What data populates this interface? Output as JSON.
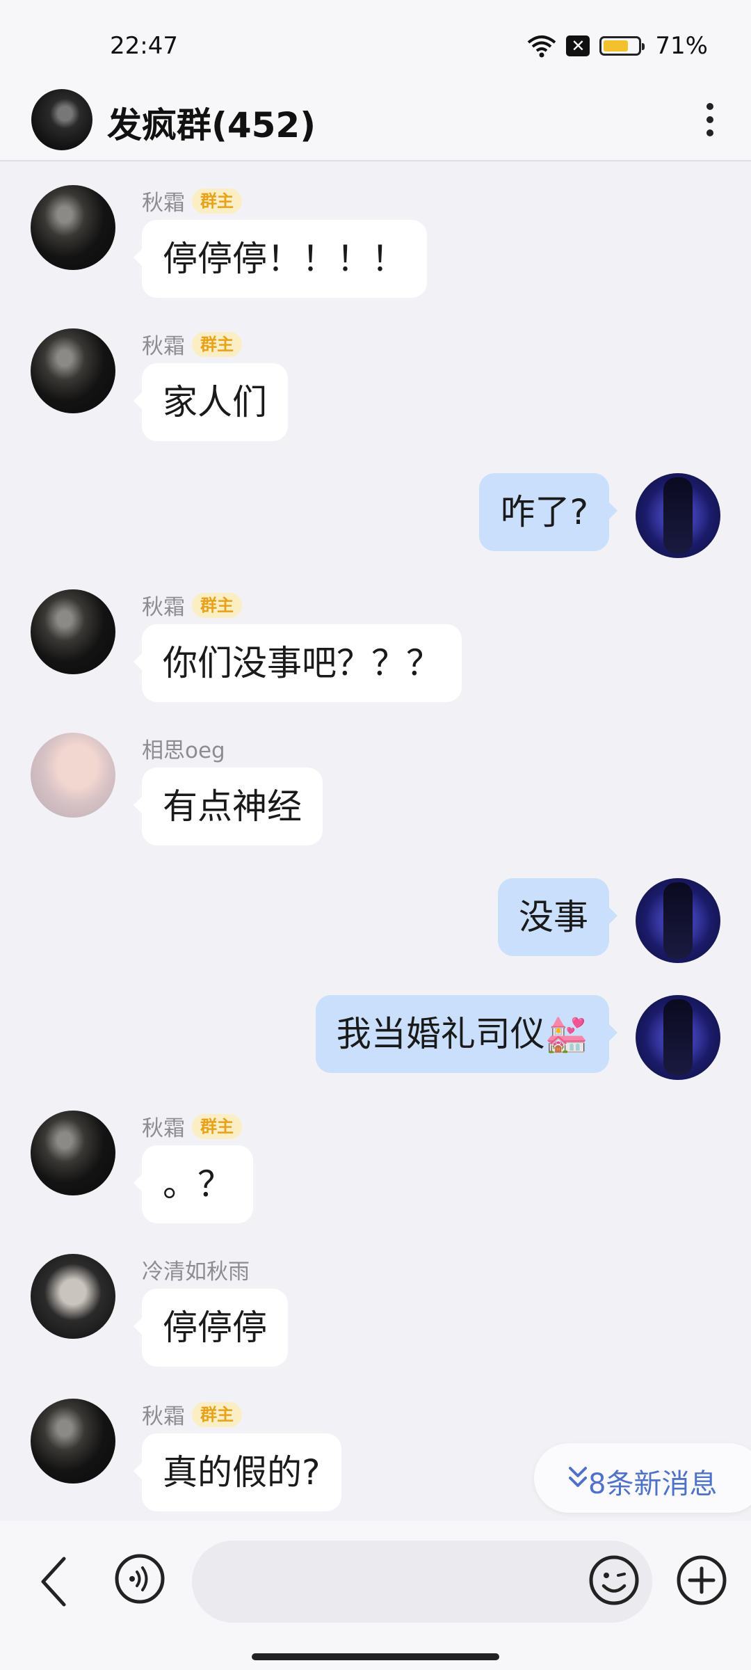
{
  "status_bar": {
    "time": "22:47",
    "battery_pct": "71%",
    "battery_level": 0.71
  },
  "header": {
    "title": "发疯群(452)"
  },
  "messages": [
    {
      "side": "in",
      "sender": "秋霜",
      "badge": "群主",
      "text": "停停停！！！！"
    },
    {
      "side": "in",
      "sender": "秋霜",
      "badge": "群主",
      "text": "家人们"
    },
    {
      "side": "out",
      "text": "咋了?"
    },
    {
      "side": "in",
      "sender": "秋霜",
      "badge": "群主",
      "text": "你们没事吧？？？"
    },
    {
      "side": "in",
      "sender": "相思oeg",
      "text": "有点神经"
    },
    {
      "side": "out",
      "text": "没事"
    },
    {
      "side": "out",
      "text": "我当婚礼司仪💒"
    },
    {
      "side": "in",
      "sender": "秋霜",
      "badge": "群主",
      "text": "。？"
    },
    {
      "side": "in",
      "sender": "冷清如秋雨",
      "text": "停停停"
    },
    {
      "side": "in",
      "sender": "秋霜",
      "badge": "群主",
      "text": "真的假的?"
    }
  ],
  "new_messages": {
    "label": "8条新消息"
  },
  "input": {
    "placeholder": ""
  }
}
